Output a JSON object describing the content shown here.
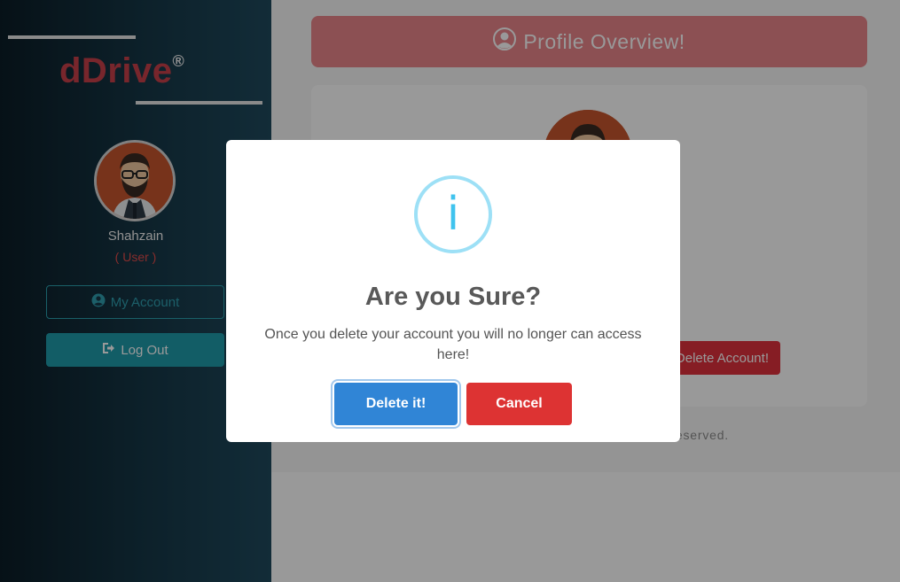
{
  "sidebar": {
    "logo_text": "dDrive",
    "logo_mark": "®",
    "user_name": "Shahzain",
    "user_role": "( User )",
    "my_account_label": "My Account",
    "my_account_icon": "user-circle-icon",
    "logout_label": "Log Out",
    "logout_icon": "sign-out-icon"
  },
  "main": {
    "header_title": "Profile Overview!",
    "header_icon": "user-circle-icon",
    "delete_account_label": "Delete Account!",
    "footer_text": "All rights reserved."
  },
  "modal": {
    "icon": "info-icon",
    "icon_glyph": "i",
    "title": "Are you Sure?",
    "text": "Once you delete your account you will no longer can access here!",
    "confirm_label": "Delete it!",
    "cancel_label": "Cancel"
  },
  "colors": {
    "accent_red": "#dd3333",
    "confirm_blue": "#3085d6",
    "teal": "#1e9bab",
    "info_blue": "#3fc3ee"
  }
}
